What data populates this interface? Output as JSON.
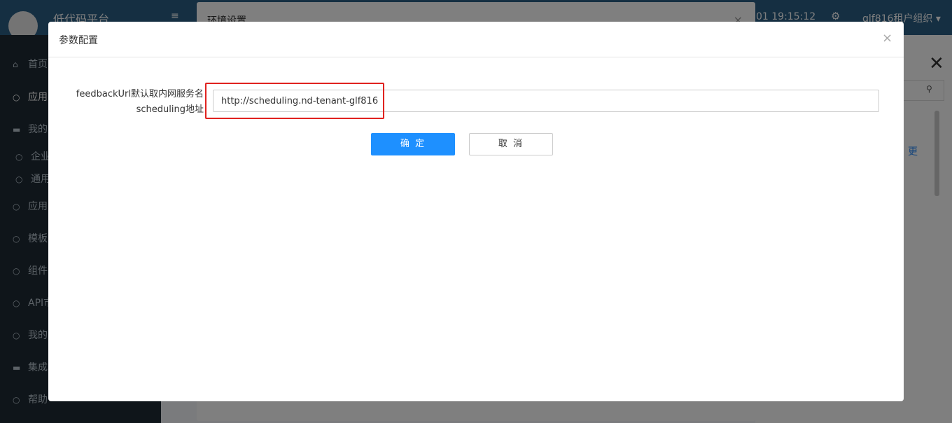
{
  "app": {
    "brand": "低代码平台",
    "datetime": "01 19:15:12",
    "org": "glf816租户组织",
    "menu_icon": "hamburger-icon",
    "settings_icon": "gear-icon"
  },
  "sidebar": {
    "items": [
      {
        "label": "首页",
        "icon": "home-icon"
      },
      {
        "label": "应用",
        "icon": "circle-icon"
      },
      {
        "label": "我的",
        "icon": "folder-icon"
      },
      {
        "label": "企业",
        "icon": "circle-icon"
      },
      {
        "label": "通用",
        "icon": "circle-icon"
      },
      {
        "label": "应用",
        "icon": "circle-icon"
      },
      {
        "label": "模板",
        "icon": "circle-icon"
      },
      {
        "label": "组件",
        "icon": "circle-icon"
      },
      {
        "label": "API市",
        "icon": "circle-icon"
      },
      {
        "label": "我的",
        "icon": "circle-icon"
      },
      {
        "label": "集成",
        "icon": "folder-icon"
      },
      {
        "label": "帮助",
        "icon": "circle-icon"
      }
    ]
  },
  "env_dialog": {
    "title": "环境设置",
    "close": "×"
  },
  "right_panel": {
    "close": "✕",
    "more": "更"
  },
  "modal": {
    "title": "参数配置",
    "close": "×",
    "field": {
      "label_line1": "feedbackUrl默认取内网服务名",
      "label_line2": "scheduling地址",
      "value": "http://scheduling.nd-tenant-glf816"
    },
    "confirm_label": "确 定",
    "cancel_label": "取 消"
  },
  "colors": {
    "topbar": "#2b5f85",
    "sidebar": "#1e2a35",
    "primary": "#1e90ff",
    "highlight": "#e0221f"
  }
}
